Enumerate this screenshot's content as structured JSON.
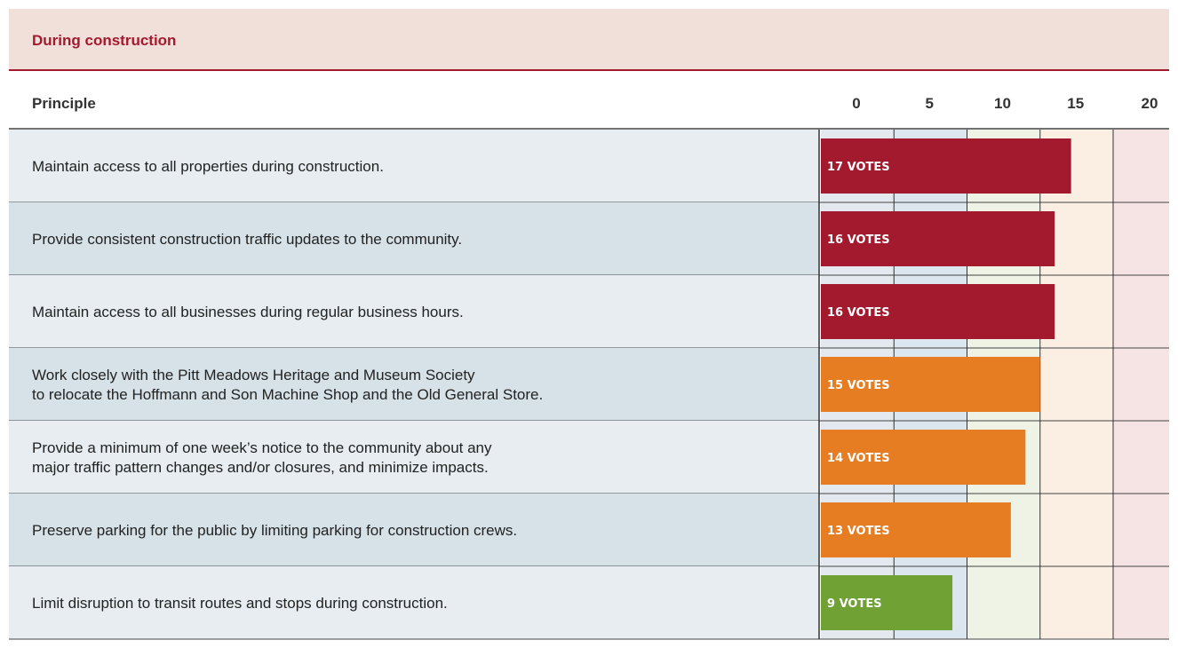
{
  "section": {
    "title": "During construction"
  },
  "table": {
    "principle_header": "Principle"
  },
  "colors": {
    "accent": "#a31a2e",
    "orange": "#e77d23",
    "green": "#6fa134",
    "header_bg": "#f1dfd9",
    "row_bg_a": "#e7edf0",
    "row_bg_b": "#d6e2e8"
  },
  "chart_data": {
    "type": "bar",
    "orientation": "horizontal",
    "title": "During construction",
    "xlim": [
      0,
      20
    ],
    "ticks": [
      0,
      5,
      10,
      15,
      20
    ],
    "categories": [
      "Maintain access to all properties during construction.",
      "Provide consistent construction traffic updates to the community.",
      "Maintain access to all businesses during regular business hours.",
      "Work closely with the Pitt Meadows Heritage and Museum Society\nto relocate the Hoffmann and Son Machine Shop and the Old General Store.",
      "Provide a minimum of one week’s notice to the community about any\nmajor traffic pattern changes and/or closures, and minimize impacts.",
      "Preserve parking for the public by limiting parking for construction crews.",
      "Limit disruption to transit routes and stops during construction."
    ],
    "values": [
      17,
      16,
      16,
      15,
      14,
      13,
      9
    ],
    "data_labels": [
      "17 VOTES",
      "16 VOTES",
      "16 VOTES",
      "15 VOTES",
      "14 VOTES",
      "13 VOTES",
      "9 VOTES"
    ],
    "bar_colors": [
      "#a31a2e",
      "#a31a2e",
      "#a31a2e",
      "#e77d23",
      "#e77d23",
      "#e77d23",
      "#6fa134"
    ]
  }
}
